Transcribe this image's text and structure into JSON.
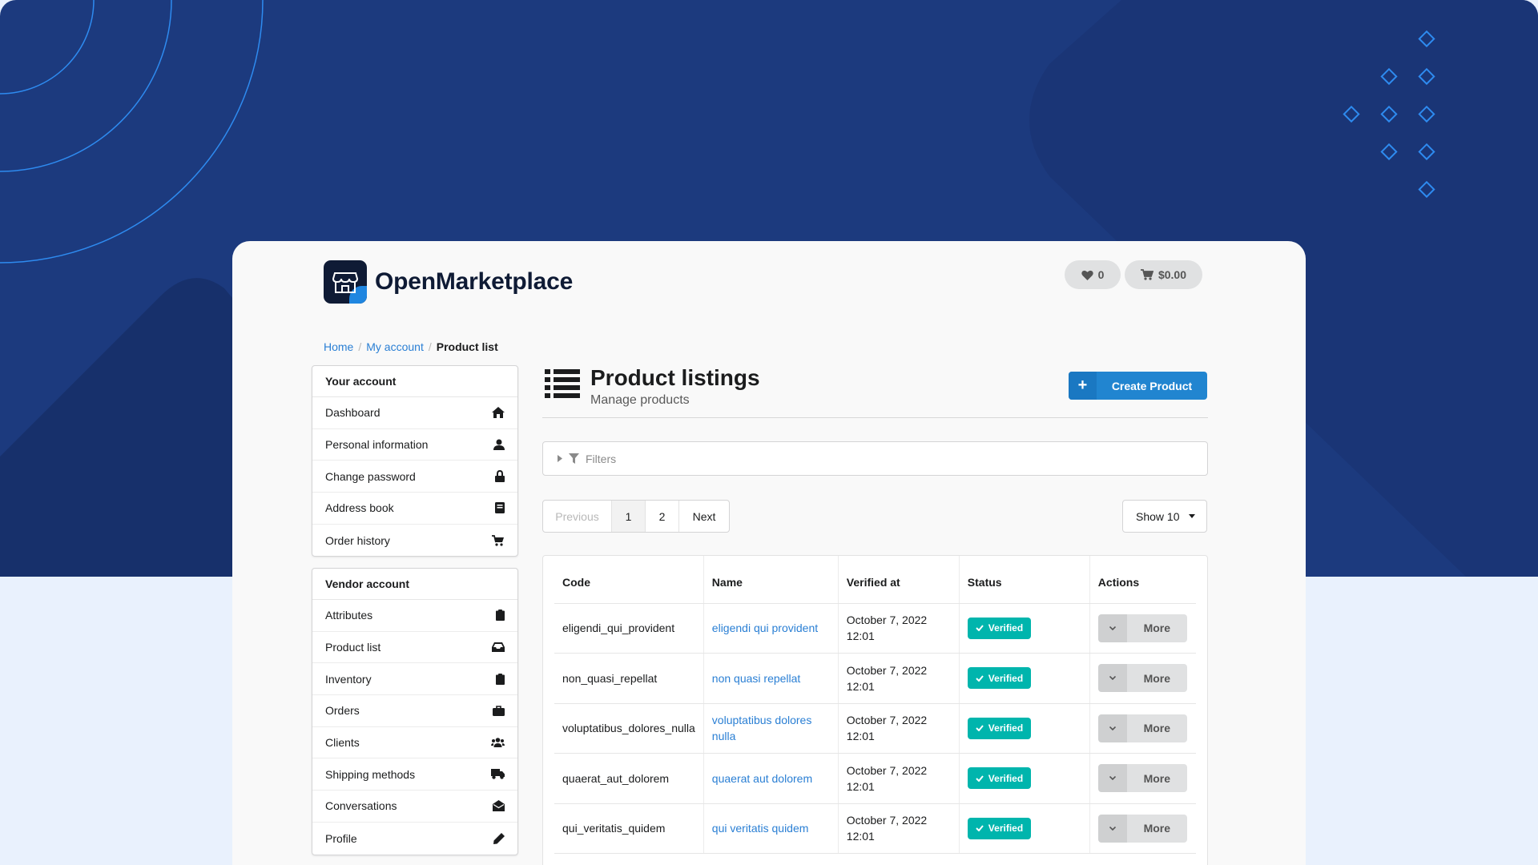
{
  "brand": {
    "name": "OpenMarketplace"
  },
  "header": {
    "wishlist_count": "0",
    "cart_total": "$0.00"
  },
  "breadcrumb": {
    "home": "Home",
    "account": "My account",
    "current": "Product list"
  },
  "account_menu": {
    "title": "Your account",
    "items": [
      {
        "label": "Dashboard",
        "icon": "home-icon"
      },
      {
        "label": "Personal information",
        "icon": "user-icon"
      },
      {
        "label": "Change password",
        "icon": "lock-icon"
      },
      {
        "label": "Address book",
        "icon": "book-icon"
      },
      {
        "label": "Order history",
        "icon": "cart-icon"
      }
    ]
  },
  "vendor_menu": {
    "title": "Vendor account",
    "items": [
      {
        "label": "Attributes",
        "icon": "clipboard-icon"
      },
      {
        "label": "Product list",
        "icon": "inbox-icon"
      },
      {
        "label": "Inventory",
        "icon": "clipboard-icon"
      },
      {
        "label": "Orders",
        "icon": "briefcase-icon"
      },
      {
        "label": "Clients",
        "icon": "users-icon"
      },
      {
        "label": "Shipping methods",
        "icon": "truck-icon"
      },
      {
        "label": "Conversations",
        "icon": "envelope-open-icon"
      },
      {
        "label": "Profile",
        "icon": "pencil-icon"
      }
    ]
  },
  "main": {
    "title": "Product listings",
    "subtitle": "Manage products",
    "create_label": "Create Product",
    "filters_label": "Filters",
    "pagination": {
      "previous": "Previous",
      "pages": [
        "1",
        "2"
      ],
      "next": "Next"
    },
    "show_label": "Show 10"
  },
  "table": {
    "headers": {
      "code": "Code",
      "name": "Name",
      "verified_at": "Verified at",
      "status": "Status",
      "actions": "Actions"
    },
    "rows": [
      {
        "code": "eligendi_qui_provident",
        "name": "eligendi qui provident",
        "verified_line1": "October 7, 2022",
        "verified_line2": "12:01",
        "status": "Verified",
        "action": "More"
      },
      {
        "code": "non_quasi_repellat",
        "name": "non quasi repellat",
        "verified_line1": "October 7, 2022",
        "verified_line2": "12:01",
        "status": "Verified",
        "action": "More"
      },
      {
        "code": "voluptatibus_dolores_nulla",
        "name": "voluptatibus dolores nulla",
        "verified_line1": "October 7, 2022",
        "verified_line2": "12:01",
        "status": "Verified",
        "action": "More"
      },
      {
        "code": "quaerat_aut_dolorem",
        "name": "quaerat aut dolorem",
        "verified_line1": "October 7, 2022",
        "verified_line2": "12:01",
        "status": "Verified",
        "action": "More"
      },
      {
        "code": "qui_veritatis_quidem",
        "name": "qui veritatis quidem",
        "verified_line1": "October 7, 2022",
        "verified_line2": "12:01",
        "status": "Verified",
        "action": "More"
      }
    ]
  },
  "colors": {
    "backdrop": "#1c3a7e",
    "accent": "#2185d0",
    "verified": "#00b5ad",
    "link": "#2a7fd4"
  }
}
